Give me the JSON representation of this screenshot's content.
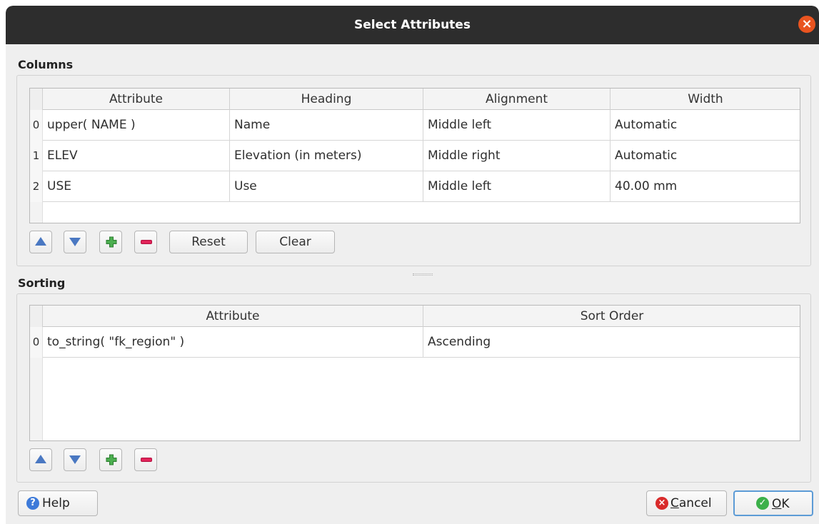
{
  "window": {
    "title": "Select Attributes",
    "close_glyph": "×"
  },
  "columns": {
    "label": "Columns",
    "headers": [
      "Attribute",
      "Heading",
      "Alignment",
      "Width"
    ],
    "rows": [
      {
        "num": "0",
        "attribute": "upper( NAME )",
        "heading": "Name",
        "alignment": "Middle left",
        "width": "Automatic"
      },
      {
        "num": "1",
        "attribute": "ELEV",
        "heading": "Elevation (in meters)",
        "alignment": "Middle right",
        "width": "Automatic"
      },
      {
        "num": "2",
        "attribute": "USE",
        "heading": "Use",
        "alignment": "Middle left",
        "width": "40.00 mm"
      }
    ],
    "buttons": {
      "reset": "Reset",
      "clear": "Clear"
    }
  },
  "sorting": {
    "label": "Sorting",
    "headers": [
      "Attribute",
      "Sort Order"
    ],
    "rows": [
      {
        "num": "0",
        "attribute": "to_string( \"fk_region\" )",
        "order": "Ascending"
      }
    ]
  },
  "footer": {
    "help": "Help",
    "cancel_prefix": "C",
    "cancel_rest": "ancel",
    "ok_prefix": "O",
    "ok_rest": "K"
  },
  "icons": {
    "move_up": "triangle-up",
    "move_down": "triangle-down",
    "add": "plus",
    "remove": "minus",
    "help": "question-circle",
    "cancel": "x-circle",
    "ok": "check-circle"
  },
  "colors": {
    "titlebar": "#2d2d2d",
    "close": "#e95420",
    "arrow": "#4a78c2",
    "add": "#4caf50",
    "remove": "#e2245a",
    "help": "#3d7ad9",
    "ok": "#3cb04a"
  }
}
